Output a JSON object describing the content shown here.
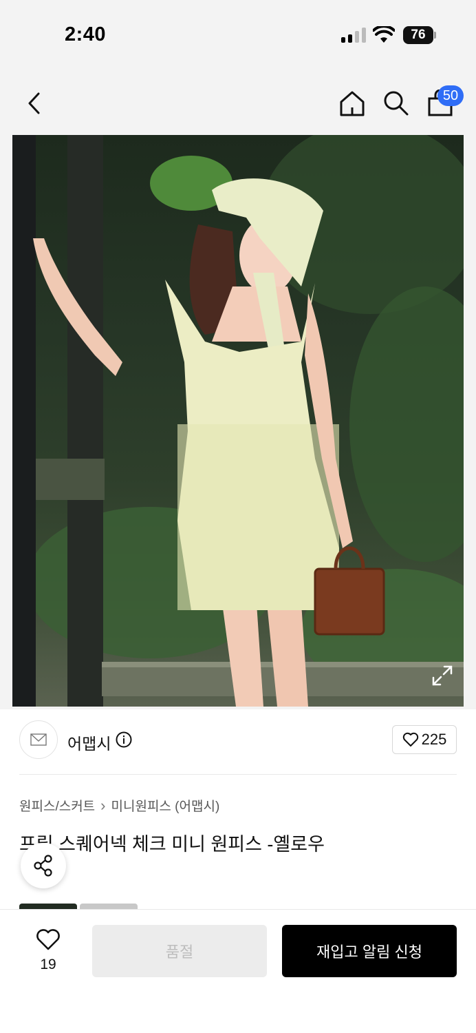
{
  "status_bar": {
    "time": "2:40",
    "battery": "76"
  },
  "header": {
    "cart_count": "50"
  },
  "shop": {
    "name": "어맵시",
    "like_count": "225"
  },
  "breadcrumb": {
    "category": "원피스/스커트",
    "subcategory": "미니원피스 (어맵시)"
  },
  "product": {
    "title": "프릴 스퀘어넥 체크 미니 원피스 -옐로우"
  },
  "bottom_bar": {
    "wish_count": "19",
    "soldout_label": "품절",
    "restock_label": "재입고 알림 신청"
  },
  "colors": {
    "accent": "#2f6df6",
    "primary_button": "#000000",
    "disabled_button": "#ececec"
  }
}
